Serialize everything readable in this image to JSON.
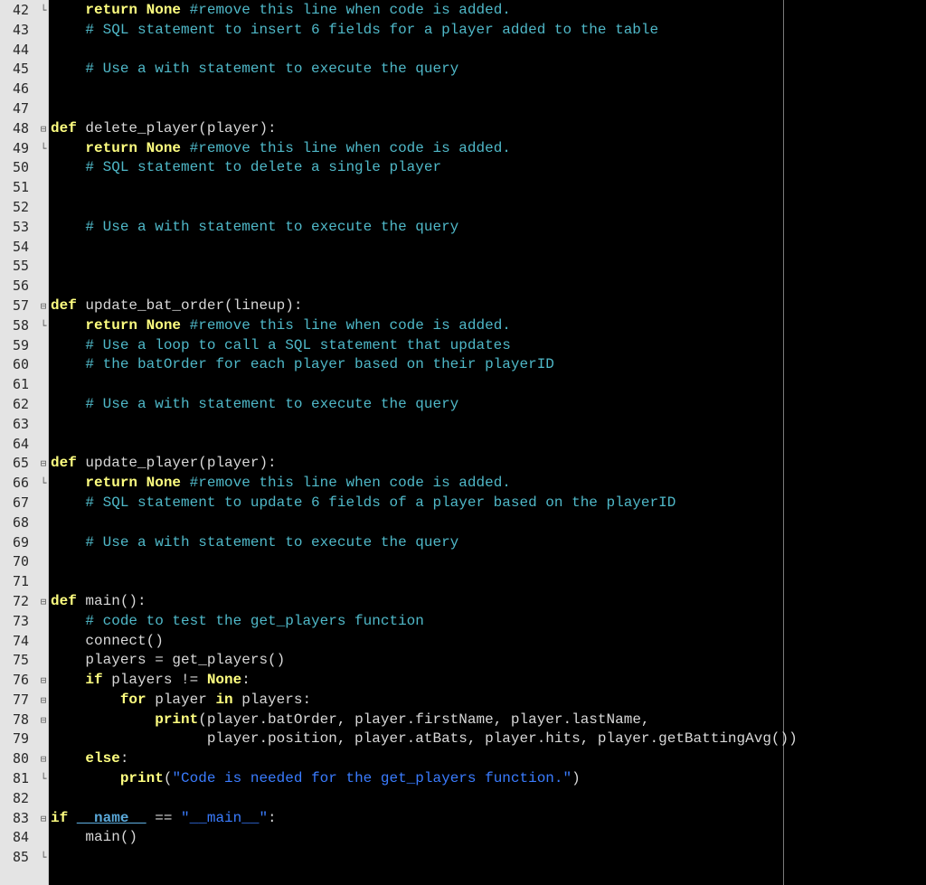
{
  "editor": {
    "colors": {
      "background": "#000000",
      "gutter": "#e4e4e4",
      "keyword": "#ffff80",
      "comment": "#4fb8c8",
      "string": "#3a7cff",
      "identifier": "#d8d8d8"
    },
    "lines": [
      {
        "n": "42",
        "fold": "end",
        "tokens": [
          [
            "ws",
            "    "
          ],
          [
            "kw",
            "return"
          ],
          [
            "id",
            " "
          ],
          [
            "kw",
            "None"
          ],
          [
            "id",
            " "
          ],
          [
            "com",
            "#remove this line when code is added."
          ]
        ]
      },
      {
        "n": "43",
        "fold": "",
        "tokens": [
          [
            "ws",
            "    "
          ],
          [
            "com",
            "# SQL statement to insert 6 fields for a player added to the table"
          ]
        ]
      },
      {
        "n": "44",
        "fold": "",
        "tokens": []
      },
      {
        "n": "45",
        "fold": "",
        "tokens": [
          [
            "ws",
            "    "
          ],
          [
            "com",
            "# Use a with statement to execute the query"
          ]
        ]
      },
      {
        "n": "46",
        "fold": "",
        "tokens": []
      },
      {
        "n": "47",
        "fold": "",
        "tokens": []
      },
      {
        "n": "48",
        "fold": "start",
        "tokens": [
          [
            "kw",
            "def"
          ],
          [
            "id",
            " delete_player(player):"
          ]
        ]
      },
      {
        "n": "49",
        "fold": "end",
        "tokens": [
          [
            "ws",
            "    "
          ],
          [
            "kw",
            "return"
          ],
          [
            "id",
            " "
          ],
          [
            "kw",
            "None"
          ],
          [
            "id",
            " "
          ],
          [
            "com",
            "#remove this line when code is added."
          ]
        ]
      },
      {
        "n": "50",
        "fold": "",
        "tokens": [
          [
            "ws",
            "    "
          ],
          [
            "com",
            "# SQL statement to delete a single player"
          ]
        ]
      },
      {
        "n": "51",
        "fold": "",
        "tokens": []
      },
      {
        "n": "52",
        "fold": "",
        "tokens": []
      },
      {
        "n": "53",
        "fold": "",
        "tokens": [
          [
            "ws",
            "    "
          ],
          [
            "com",
            "# Use a with statement to execute the query"
          ]
        ]
      },
      {
        "n": "54",
        "fold": "",
        "tokens": []
      },
      {
        "n": "55",
        "fold": "",
        "tokens": []
      },
      {
        "n": "56",
        "fold": "",
        "tokens": []
      },
      {
        "n": "57",
        "fold": "start",
        "tokens": [
          [
            "kw",
            "def"
          ],
          [
            "id",
            " update_bat_order(lineup):"
          ]
        ]
      },
      {
        "n": "58",
        "fold": "end",
        "tokens": [
          [
            "ws",
            "    "
          ],
          [
            "kw",
            "return"
          ],
          [
            "id",
            " "
          ],
          [
            "kw",
            "None"
          ],
          [
            "id",
            " "
          ],
          [
            "com",
            "#remove this line when code is added."
          ]
        ]
      },
      {
        "n": "59",
        "fold": "",
        "tokens": [
          [
            "ws",
            "    "
          ],
          [
            "com",
            "# Use a loop to call a SQL statement that updates"
          ]
        ]
      },
      {
        "n": "60",
        "fold": "",
        "tokens": [
          [
            "ws",
            "    "
          ],
          [
            "com",
            "# the batOrder for each player based on their playerID"
          ]
        ]
      },
      {
        "n": "61",
        "fold": "",
        "tokens": []
      },
      {
        "n": "62",
        "fold": "",
        "tokens": [
          [
            "ws",
            "    "
          ],
          [
            "com",
            "# Use a with statement to execute the query"
          ]
        ]
      },
      {
        "n": "63",
        "fold": "",
        "tokens": []
      },
      {
        "n": "64",
        "fold": "",
        "tokens": []
      },
      {
        "n": "65",
        "fold": "start",
        "tokens": [
          [
            "kw",
            "def"
          ],
          [
            "id",
            " update_player(player):"
          ]
        ]
      },
      {
        "n": "66",
        "fold": "end",
        "tokens": [
          [
            "ws",
            "    "
          ],
          [
            "kw",
            "return"
          ],
          [
            "id",
            " "
          ],
          [
            "kw",
            "None"
          ],
          [
            "id",
            " "
          ],
          [
            "com",
            "#remove this line when code is added."
          ]
        ]
      },
      {
        "n": "67",
        "fold": "",
        "tokens": [
          [
            "ws",
            "    "
          ],
          [
            "com",
            "# SQL statement to update 6 fields of a player based on the playerID"
          ]
        ]
      },
      {
        "n": "68",
        "fold": "",
        "tokens": []
      },
      {
        "n": "69",
        "fold": "",
        "tokens": [
          [
            "ws",
            "    "
          ],
          [
            "com",
            "# Use a with statement to execute the query"
          ]
        ]
      },
      {
        "n": "70",
        "fold": "",
        "tokens": []
      },
      {
        "n": "71",
        "fold": "",
        "tokens": []
      },
      {
        "n": "72",
        "fold": "start",
        "tokens": [
          [
            "kw",
            "def"
          ],
          [
            "id",
            " main():"
          ]
        ]
      },
      {
        "n": "73",
        "fold": "",
        "tokens": [
          [
            "ws",
            "    "
          ],
          [
            "com",
            "# code to test the get_players function"
          ]
        ]
      },
      {
        "n": "74",
        "fold": "",
        "tokens": [
          [
            "ws",
            "    "
          ],
          [
            "id",
            "connect()"
          ]
        ]
      },
      {
        "n": "75",
        "fold": "",
        "tokens": [
          [
            "ws",
            "    "
          ],
          [
            "id",
            "players = get_players()"
          ]
        ]
      },
      {
        "n": "76",
        "fold": "start",
        "tokens": [
          [
            "ws",
            "    "
          ],
          [
            "kw",
            "if"
          ],
          [
            "id",
            " players != "
          ],
          [
            "kw",
            "None"
          ],
          [
            "id",
            ":"
          ]
        ]
      },
      {
        "n": "77",
        "fold": "start",
        "tokens": [
          [
            "ws",
            "        "
          ],
          [
            "kw",
            "for"
          ],
          [
            "id",
            " player "
          ],
          [
            "kw",
            "in"
          ],
          [
            "id",
            " players:"
          ]
        ]
      },
      {
        "n": "78",
        "fold": "start",
        "tokens": [
          [
            "ws",
            "            "
          ],
          [
            "kw",
            "print"
          ],
          [
            "id",
            "(player.batOrder, player.firstName, player.lastName,"
          ]
        ]
      },
      {
        "n": "79",
        "fold": "",
        "tokens": [
          [
            "ws",
            "                  "
          ],
          [
            "id",
            "player.position, player.atBats, player.hits, player.getBattingAvg())"
          ]
        ]
      },
      {
        "n": "80",
        "fold": "start",
        "tokens": [
          [
            "ws",
            "    "
          ],
          [
            "kw",
            "else"
          ],
          [
            "id",
            ":"
          ]
        ]
      },
      {
        "n": "81",
        "fold": "end",
        "tokens": [
          [
            "ws",
            "        "
          ],
          [
            "kw",
            "print"
          ],
          [
            "id",
            "("
          ],
          [
            "str",
            "\"Code is needed for the get_players function.\""
          ],
          [
            "id",
            ")"
          ]
        ]
      },
      {
        "n": "82",
        "fold": "",
        "tokens": []
      },
      {
        "n": "83",
        "fold": "start",
        "tokens": [
          [
            "kw",
            "if"
          ],
          [
            "id",
            " "
          ],
          [
            "mag",
            "__name__"
          ],
          [
            "id",
            " == "
          ],
          [
            "str",
            "\"__main__\""
          ],
          [
            "id",
            ":"
          ]
        ]
      },
      {
        "n": "84",
        "fold": "",
        "tokens": [
          [
            "ws",
            "    "
          ],
          [
            "id",
            "main()"
          ]
        ]
      },
      {
        "n": "85",
        "fold": "end",
        "tokens": []
      }
    ]
  }
}
